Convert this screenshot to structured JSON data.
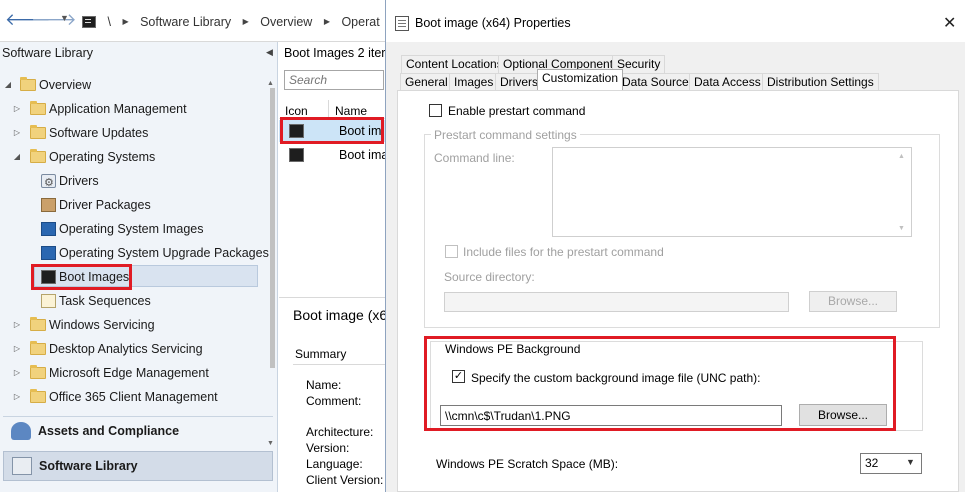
{
  "topbar": {
    "back_icon": "back-arrow-icon",
    "forward_icon": "forward-arrow-icon",
    "dropdown_icon": "chevron-down-icon",
    "breadcrumb": {
      "root": "\\",
      "items": [
        "Software Library",
        "Overview",
        "Operat"
      ]
    }
  },
  "nav": {
    "title": "Software Library",
    "tree": [
      {
        "label": "Overview",
        "expanded": true,
        "icon": "folder-icon"
      },
      {
        "label": "Application Management",
        "icon": "folder-icon"
      },
      {
        "label": "Software Updates",
        "icon": "folder-icon"
      },
      {
        "label": "Operating Systems",
        "expanded": true,
        "icon": "folder-icon"
      },
      {
        "label": "Drivers",
        "icon": "drivers-icon"
      },
      {
        "label": "Driver Packages",
        "icon": "driver-package-icon"
      },
      {
        "label": "Operating System Images",
        "icon": "os-image-icon"
      },
      {
        "label": "Operating System Upgrade Packages",
        "icon": "os-upgrade-icon"
      },
      {
        "label": "Boot Images",
        "icon": "boot-image-icon",
        "selected": true
      },
      {
        "label": "Task Sequences",
        "icon": "task-sequence-icon"
      },
      {
        "label": "Windows Servicing",
        "icon": "folder-icon"
      },
      {
        "label": "Desktop Analytics Servicing",
        "icon": "folder-icon"
      },
      {
        "label": "Microsoft Edge Management",
        "icon": "folder-icon"
      },
      {
        "label": "Office 365 Client Management",
        "icon": "folder-icon"
      }
    ],
    "workspaces": [
      "Assets and Compliance",
      "Software Library"
    ]
  },
  "list": {
    "title": "Boot Images 2 iter",
    "search_placeholder": "Search",
    "columns": [
      "Icon",
      "Name"
    ],
    "rows": [
      "Boot im",
      "Boot ima"
    ],
    "detail_title": "Boot image (x6",
    "summary_label": "Summary",
    "fields": [
      "Name:",
      "Comment:",
      "Architecture:",
      "Version:",
      "Language:",
      "Client Version:"
    ]
  },
  "dialog": {
    "title": "Boot image (x64) Properties",
    "close_icon": "close-icon",
    "tabs_row1": [
      "Content Locations",
      "Optional Components",
      "Security"
    ],
    "tabs_row2": [
      "General",
      "Images",
      "Drivers",
      "Customization",
      "Data Source",
      "Data Access",
      "Distribution Settings"
    ],
    "active_tab": "Customization",
    "enable_prestart": "Enable prestart command",
    "prestart_group": "Prestart command settings",
    "command_line": "Command line:",
    "include_files": "Include files for the prestart command",
    "source_directory": "Source directory:",
    "browse_disabled": "Browse...",
    "winpe_group": "Windows PE Background",
    "custom_bg_label": "Specify the custom background image file (UNC path):",
    "custom_bg_checked": true,
    "check_mark": "✓",
    "unc_path": "\\\\cmn\\c$\\Trudan\\1.PNG",
    "browse": "Browse...",
    "scratch_label": "Windows PE Scratch Space (MB):",
    "scratch_value": "32"
  },
  "colors": {
    "highlight_red": "#e01b24",
    "nav_bg": "#f0f4f9",
    "selected_row": "#cce4f7"
  }
}
